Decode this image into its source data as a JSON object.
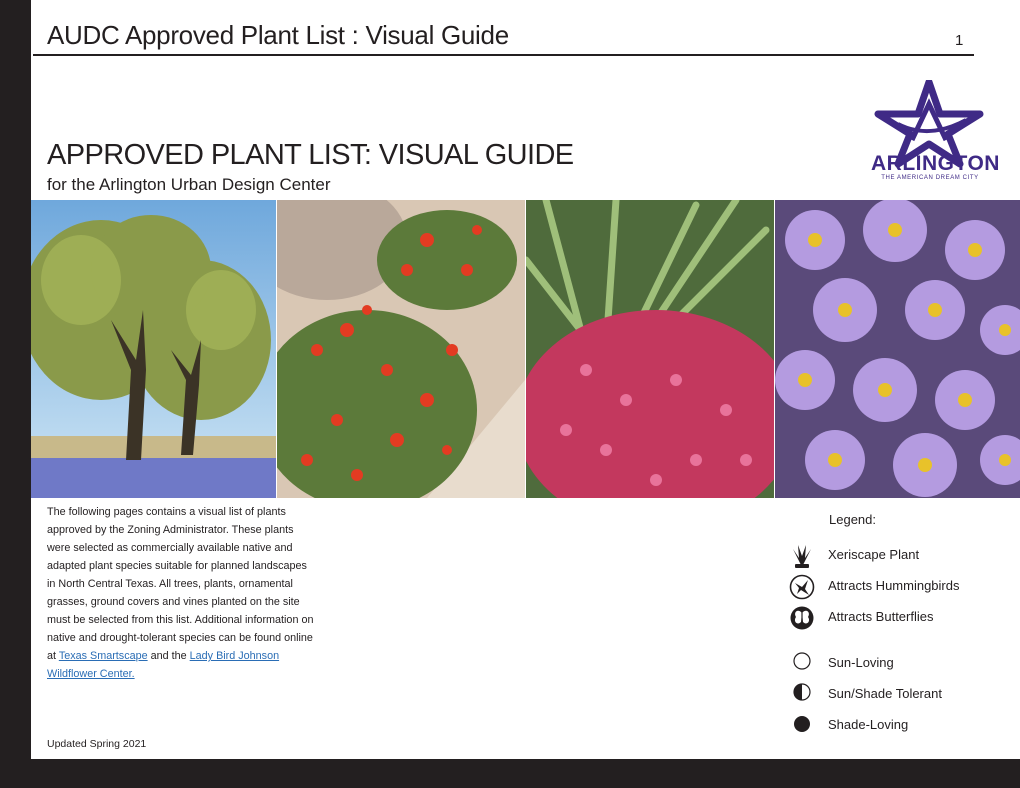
{
  "header": {
    "title": "AUDC Approved Plant List : Visual Guide",
    "page_number": "1"
  },
  "logo": {
    "wordmark": "ARLINGTON",
    "tagline": "THE AMERICAN DREAM CITY",
    "brand_color": "#3f2a86"
  },
  "main": {
    "title": "APPROVED PLANT LIST: VISUAL GUIDE",
    "subtitle": "for the Arlington Urban Design Center"
  },
  "intro": {
    "text_before_link1": "The following pages contains a visual list of plants approved by the Zoning Administrator. These plants were selected as commercially available native and adapted plant species suitable for planned landscapes in North Central Texas. All trees, plants, ornamental grasses, ground covers and vines planted on the site must be selected from this list. Additional information on native and drought-tolerant species can be found online at ",
    "link1": "Texas Smartscape",
    "text_between_links": " and the ",
    "link2": "Lady Bird Johnson Wildflower Center.",
    "link_color": "#2a6db5"
  },
  "updated": "Updated Spring 2021",
  "legend": {
    "title": "Legend:",
    "items": [
      {
        "icon": "xeriscape-plant-icon",
        "label": "Xeriscape Plant"
      },
      {
        "icon": "hummingbird-icon",
        "label": "Attracts Hummingbirds"
      },
      {
        "icon": "butterfly-icon",
        "label": "Attracts Butterflies"
      },
      {
        "icon": "sun-loving-icon",
        "label": "Sun-Loving"
      },
      {
        "icon": "sun-shade-icon",
        "label": "Sun/Shade Tolerant"
      },
      {
        "icon": "shade-loving-icon",
        "label": "Shade-Loving"
      }
    ]
  },
  "photos": [
    {
      "subject": "oak-trees-bluebonnets"
    },
    {
      "subject": "red-flowering-shrub"
    },
    {
      "subject": "pink-flowering-shrub-yucca"
    },
    {
      "subject": "purple-asters"
    }
  ]
}
